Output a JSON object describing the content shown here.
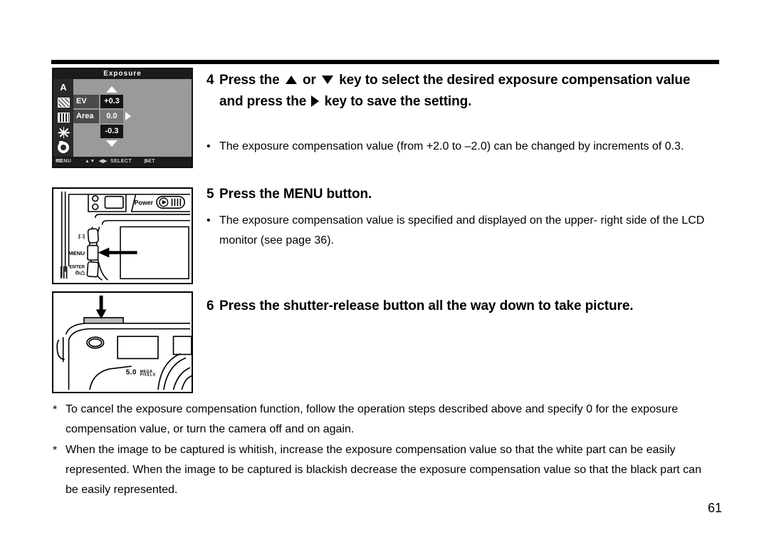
{
  "page": {
    "number": "61"
  },
  "lcd_menu": {
    "title": "Exposure",
    "icons": [
      {
        "name": "auto-mode-icon",
        "label": "A"
      },
      {
        "name": "hatched-pattern-icon",
        "label": ""
      },
      {
        "name": "vertical-bars-icon",
        "label": ""
      },
      {
        "name": "brightness-icon",
        "label": ""
      },
      {
        "name": "camera-shutter-icon",
        "label": ""
      }
    ],
    "rows": [
      {
        "label": "EV",
        "value": "+0.3"
      },
      {
        "label": "Area",
        "value": "0.0"
      },
      {
        "label": "",
        "value": "-0.3"
      }
    ],
    "footer": {
      "menu": "MENU",
      "page": "P2",
      "updown": "▲▼",
      "leftright": "◀▶",
      "select": "SELECT",
      "set_arrow": "▷",
      "set": "SET"
    }
  },
  "illustration_back": {
    "power_label": "Power",
    "display_button_label": "|□|",
    "menu_button_label": "MENU",
    "enter_button_label": "ENTER",
    "enter_sub_label": "⏱/♻"
  },
  "illustration_top": {
    "brand_text": "5.0",
    "brand_sub_1": "MEGA",
    "brand_sub_2": "PIXELS"
  },
  "steps": [
    {
      "number": "4",
      "text_before": "Press the",
      "text_middle": "or",
      "text_after": "key to select the desired exposure compensation value and press the",
      "text_end": "key to save the setting."
    },
    {
      "number": "5",
      "text": "Press the MENU button."
    },
    {
      "number": "6",
      "text": "Press the shutter-release button all the way down to take picture."
    }
  ],
  "bullets": [
    {
      "marker": "•",
      "text": "The exposure compensation value (from +2.0 to –2.0) can be changed by increments of 0.3."
    },
    {
      "marker": "•",
      "text": "The exposure compensation value is specified and displayed on the upper- right side of the LCD monitor (see page 36)."
    }
  ],
  "notes": [
    {
      "marker": "*",
      "text": "To cancel the exposure compensation function, follow the operation steps described above and specify 0 for the exposure compensation value, or turn the camera off and on again."
    },
    {
      "marker": "*",
      "text": "When the image to be captured is whitish, increase the exposure compensation value so that the white part can be easily represented. When the image to be captured is blackish decrease the exposure compensation value so that the black part can be easily represented."
    }
  ],
  "colors": {
    "text": "#000000",
    "rule": "#000000",
    "lcd_background": "#9a9a9a",
    "lcd_header": "#1b1b1b",
    "lcd_value_box": "#141414",
    "lcd_label_box": "#4a4a4a"
  }
}
